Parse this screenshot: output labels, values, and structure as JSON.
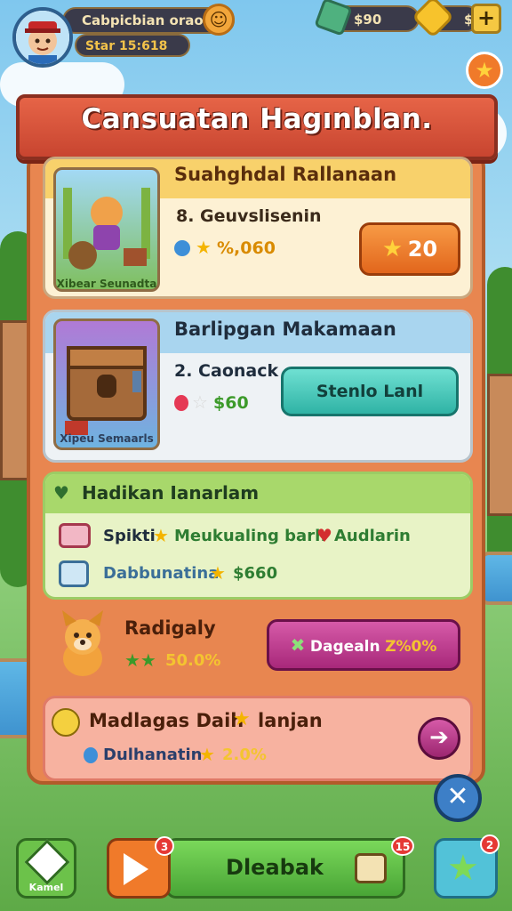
{
  "header": {
    "player_name": "Cabpicbian oraon",
    "player_stat": "Star 15:618",
    "currency_value": "$90",
    "gold_value": "$",
    "plus_label": "+",
    "emoji_label": "☺"
  },
  "panel": {
    "title": "Cansuatan Hagınblan."
  },
  "card1": {
    "title": "Suahghdal Rallanaan",
    "thumb_caption": "Xibear Seunadta",
    "subtitle": "8. Geuvslisenin",
    "reward": "%,060",
    "button_label": "20"
  },
  "card2": {
    "title": "Barlipgan Makamaan",
    "thumb_caption": "Xipeu Semaarls",
    "subtitle": "2. Caonack",
    "reward": "$60",
    "button_label": "Stenlo Lanl"
  },
  "card3": {
    "title": "Hadikan Ianarlam",
    "row1_label": "Spikti",
    "row1_text": "Meukualing barh",
    "row1_suffix": "Audlarin",
    "row2_label": "Dabbunatina",
    "row2_value": "$660"
  },
  "card4": {
    "title": "Radigaly",
    "value": "50.0%",
    "button_label": "Dagealn",
    "button_value": "Z%0%"
  },
  "card5": {
    "title": "Madlagas Daih",
    "title_suffix": "lanjan",
    "subtitle": "Dulhanatin",
    "value": "2.0%"
  },
  "bottom_nav": {
    "left_label": "Kamel",
    "main_label": "Dleabak",
    "notif_play": "3",
    "notif_main": "15",
    "notif_right": "2"
  },
  "colors": {
    "panel": "#e88650",
    "banner": "#d6523a",
    "primary_button": "#f07a2a",
    "teal_button": "#4fc3b8",
    "magenta_button": "#c33b8f"
  }
}
